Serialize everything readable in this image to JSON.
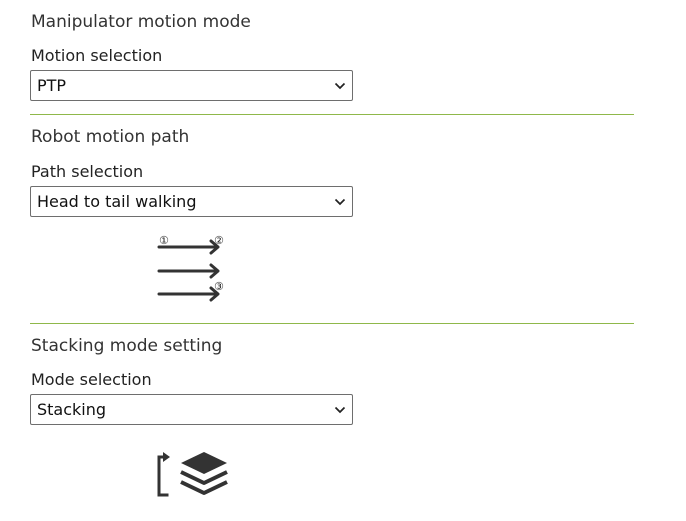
{
  "motion_mode": {
    "title": "Manipulator motion mode",
    "label": "Motion selection",
    "selected": "PTP",
    "icon": "chevron-down-icon"
  },
  "motion_path": {
    "title": "Robot motion path",
    "label": "Path selection",
    "selected": "Head to tail walking",
    "icon": "chevron-down-icon",
    "diagram": {
      "icon": "path-arrows-icon",
      "markers": [
        "①",
        "②",
        "③"
      ]
    }
  },
  "stacking_mode": {
    "title": "Stacking mode setting",
    "label": "Mode selection",
    "selected": "Stacking",
    "icon": "chevron-down-icon",
    "diagram": {
      "icon": "stacking-layers-icon"
    }
  },
  "colors": {
    "divider": "#8fb84a",
    "text": "#333333",
    "icon": "#333333"
  }
}
